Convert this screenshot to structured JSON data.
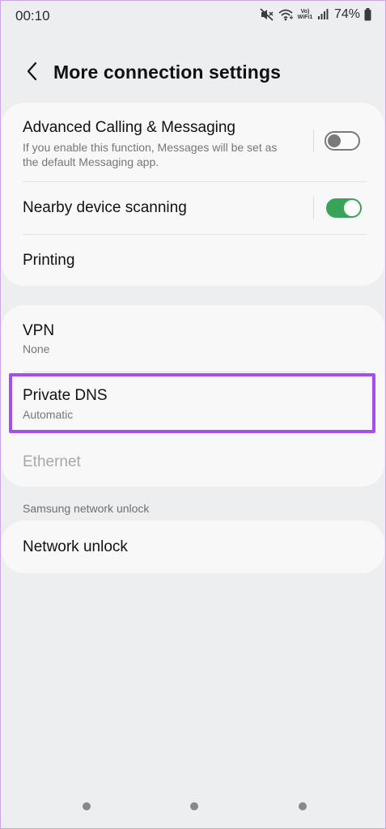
{
  "status_bar": {
    "time": "00:10",
    "volte_line1": "Vo)",
    "volte_line2": "WiFi1",
    "battery": "74%",
    "icons": [
      "mute-icon",
      "wifi-icon",
      "volte-wifi-icon",
      "signal-icon",
      "battery-icon"
    ]
  },
  "header": {
    "title": "More connection settings",
    "back_icon": "chevron-left-icon"
  },
  "card1": {
    "advanced": {
      "title": "Advanced Calling & Messaging",
      "description_line1": "If you enable this function, Messages will be set as",
      "description_line2": "the default Messaging app.",
      "enabled": false
    },
    "nearby": {
      "title": "Nearby device scanning",
      "enabled": true
    },
    "printing": {
      "title": "Printing"
    }
  },
  "card2": {
    "vpn": {
      "title": "VPN",
      "subtitle": "None"
    },
    "private_dns": {
      "title": "Private DNS",
      "subtitle": "Automatic"
    },
    "ethernet": {
      "title": "Ethernet"
    }
  },
  "samsung_section": {
    "label": "Samsung network unlock",
    "network_unlock": {
      "title": "Network unlock"
    }
  },
  "colors": {
    "background": "#eceef0",
    "card": "#f8f8f8",
    "toggle_on": "#3aa35a",
    "highlight": "#a64df2",
    "disabled_text": "#a8a8a8"
  }
}
